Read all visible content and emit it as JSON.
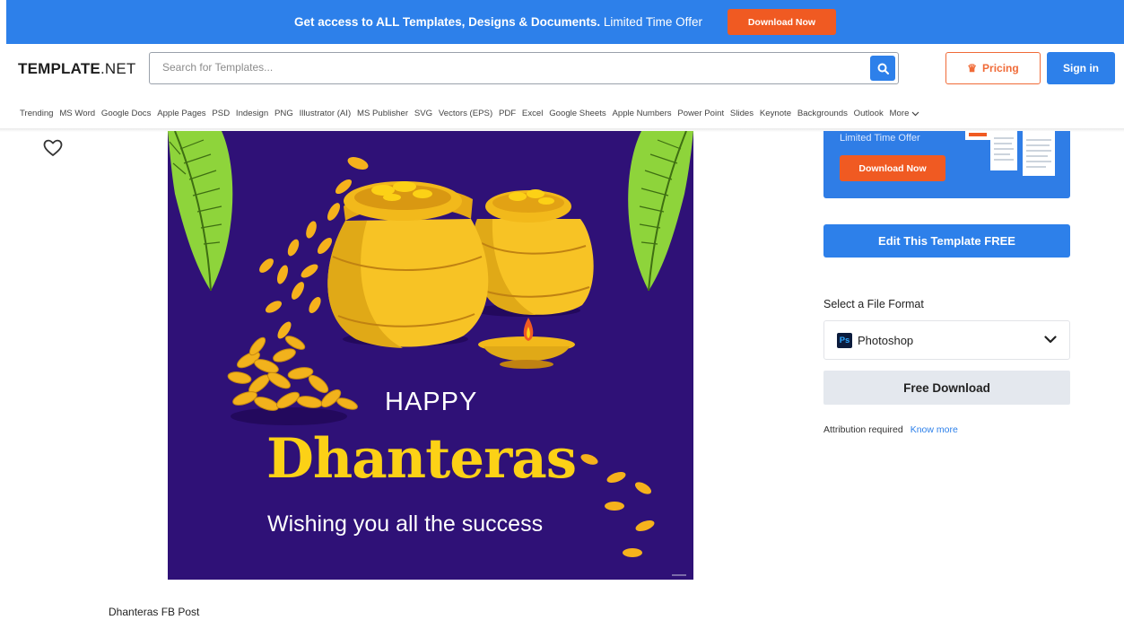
{
  "promo": {
    "text_bold": "Get access to ALL Templates, Designs & Documents.",
    "text_light": "Limited Time Offer",
    "button": "Download Now"
  },
  "header": {
    "logo_main": "TEMPLATE",
    "logo_suffix": ".NET",
    "search_placeholder": "Search for Templates...",
    "pricing_label": "Pricing",
    "signin_label": "Sign in"
  },
  "nav": {
    "items": [
      "Trending",
      "MS Word",
      "Google Docs",
      "Apple Pages",
      "PSD",
      "Indesign",
      "PNG",
      "Illustrator (AI)",
      "MS Publisher",
      "SVG",
      "Vectors (EPS)",
      "PDF",
      "Excel",
      "Google Sheets",
      "Apple Numbers",
      "Power Point",
      "Slides",
      "Keynote",
      "Backgrounds",
      "Outlook"
    ],
    "more_label": "More"
  },
  "poster": {
    "line1": "HAPPY",
    "line2": "Dhanteras",
    "line3": "Wishing you all the success"
  },
  "offer_card": {
    "text": "Limited Time Offer",
    "button": "Download Now"
  },
  "sidebar": {
    "edit_button": "Edit This Template FREE",
    "format_label": "Select a File Format",
    "format_icon": "Ps",
    "format_value": "Photoshop",
    "download_button": "Free Download",
    "attribution_text": "Attribution required",
    "attribution_link": "Know more"
  },
  "template_title": "Dhanteras FB Post",
  "colors": {
    "brand_blue": "#2d80ea",
    "accent_orange": "#f05a22",
    "poster_bg": "#2f1177",
    "gold": "#fcd116"
  }
}
